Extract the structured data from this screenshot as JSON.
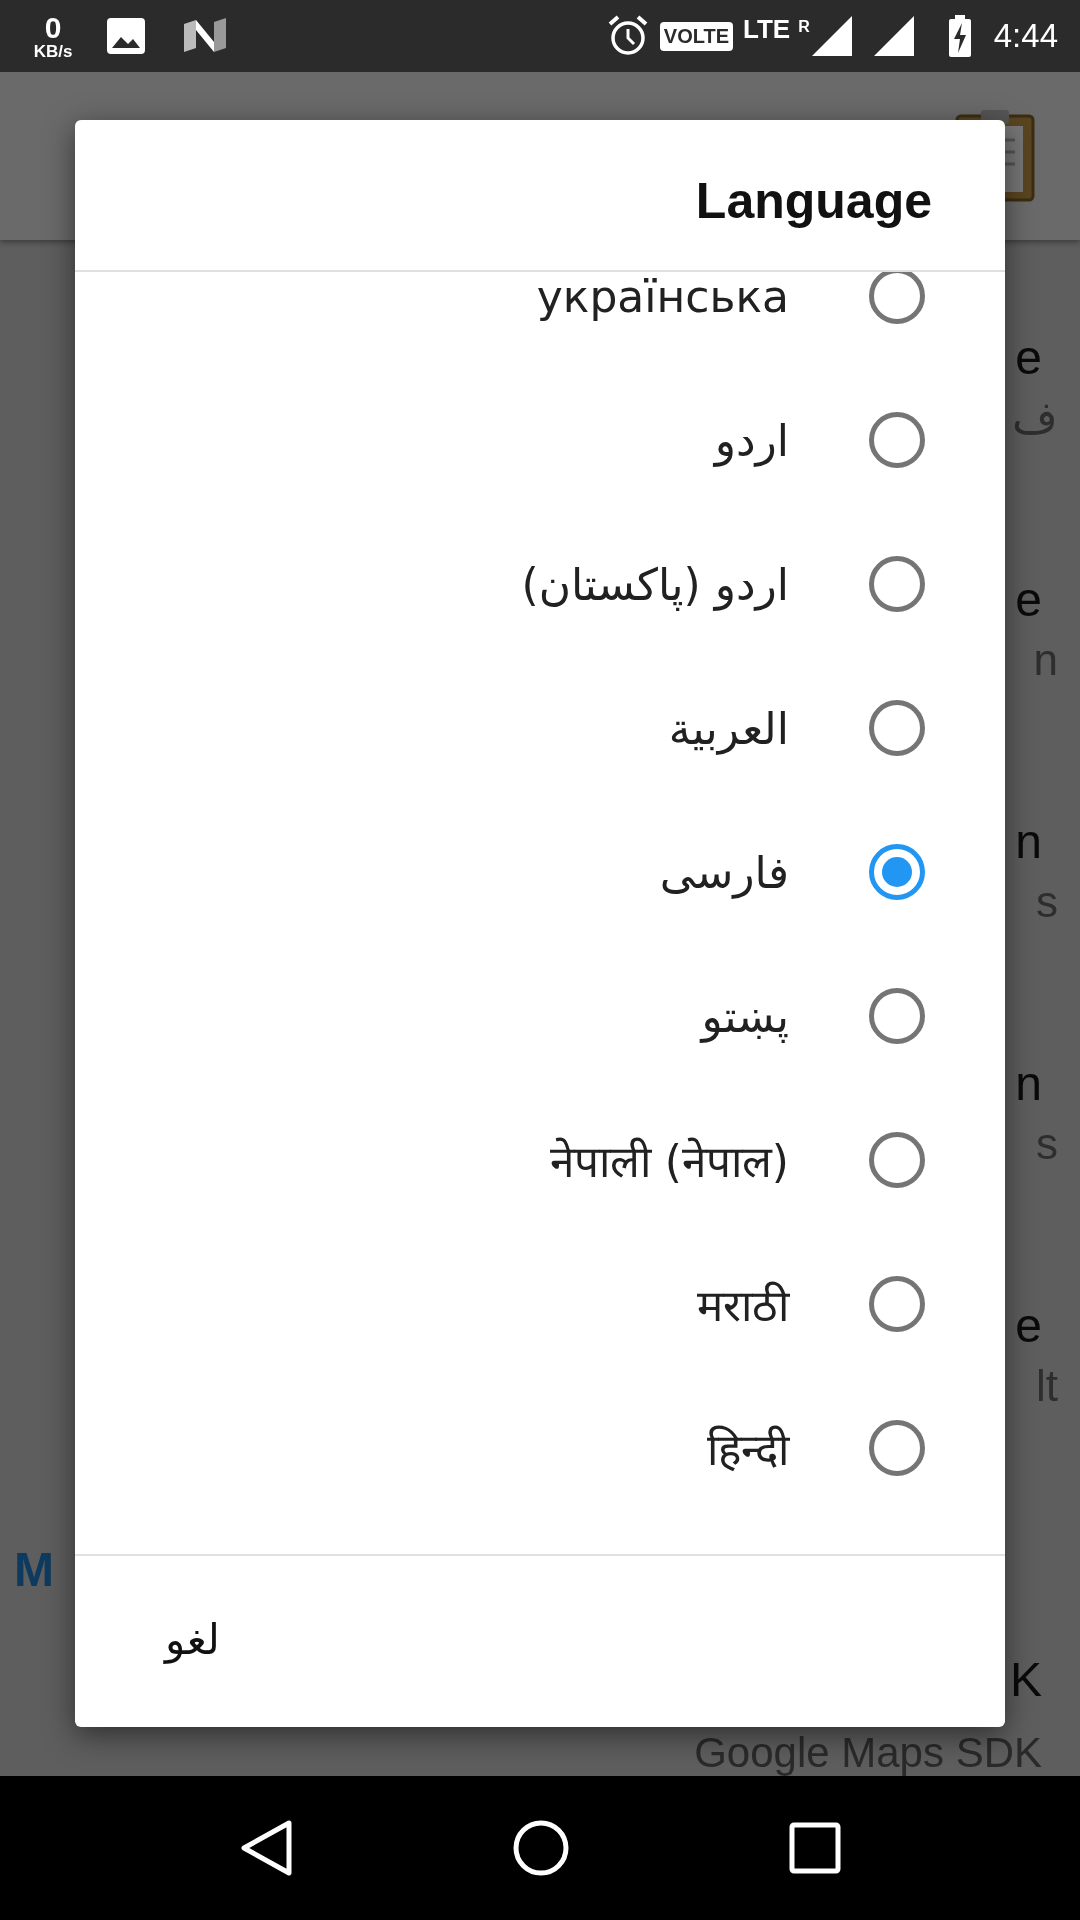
{
  "status_bar": {
    "speed_value": "0",
    "speed_unit": "KB/s",
    "badge": "VOLTE",
    "network": "LTE",
    "roaming": "R",
    "time": "4:44"
  },
  "background": {
    "rows": [
      {
        "title": "e",
        "subtitle": "ف"
      },
      {
        "title": "e",
        "subtitle": "n"
      },
      {
        "title": "n",
        "subtitle": "s"
      },
      {
        "title": "n",
        "subtitle": "s"
      },
      {
        "title": "e",
        "subtitle": "lt"
      }
    ],
    "section_heading": "M",
    "last_title": "K",
    "last_subtitle": "Google Maps SDK"
  },
  "dialog": {
    "title": "Language",
    "options": [
      {
        "label": "українська",
        "selected": false
      },
      {
        "label": "اردو",
        "selected": false
      },
      {
        "label": "اردو (پاکستان)",
        "selected": false
      },
      {
        "label": "العربية",
        "selected": false
      },
      {
        "label": "فارسی",
        "selected": true
      },
      {
        "label": "پښتو",
        "selected": false
      },
      {
        "label": "नेपाली (नेपाल)",
        "selected": false
      },
      {
        "label": "मराठी",
        "selected": false
      },
      {
        "label": "हिन्दी",
        "selected": false
      }
    ],
    "cancel": "لغو"
  }
}
